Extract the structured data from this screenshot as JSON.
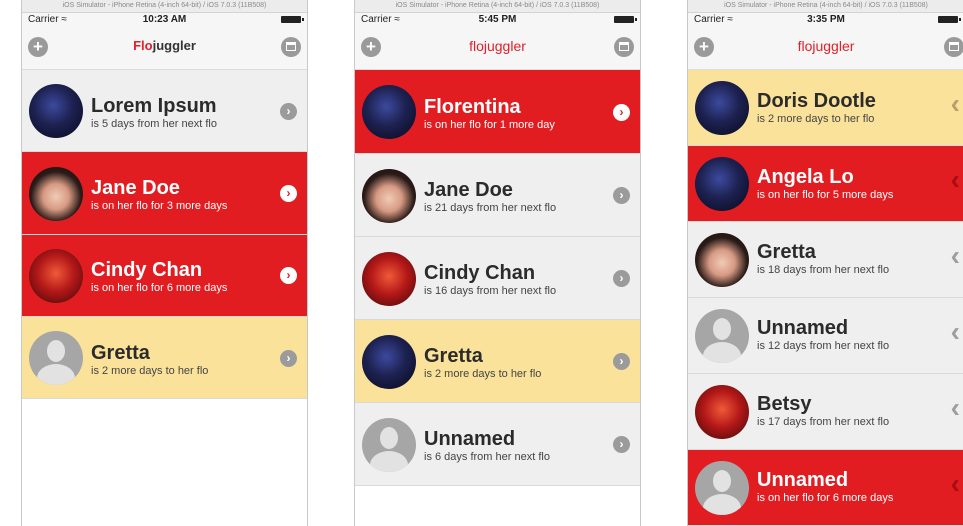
{
  "screens": [
    {
      "simulator_title": "iOS Simulator - iPhone Retina (4-inch 64-bit) / iOS 7.0.3 (11B508)",
      "carrier": "Carrier",
      "time": "10:23 AM",
      "title_part1": "Flo",
      "title_part2": "juggler",
      "rows": [
        {
          "name": "Lorem Ipsum",
          "status": "is 5 days from her next flo",
          "color": "gray"
        },
        {
          "name": "Jane Doe",
          "status": "is on her flo for 3 more days",
          "color": "red"
        },
        {
          "name": "Cindy Chan",
          "status": "is on her flo for 6 more days",
          "color": "red"
        },
        {
          "name": "Gretta",
          "status": "is 2 more days to her flo",
          "color": "yellow"
        }
      ]
    },
    {
      "simulator_title": "iOS Simulator - iPhone Retina (4-inch 64-bit) / iOS 7.0.3 (11B508)",
      "carrier": "Carrier",
      "time": "5:45 PM",
      "title": "flojuggler",
      "rows": [
        {
          "name": "Florentina",
          "status": "is on her flo for 1 more day",
          "color": "red"
        },
        {
          "name": "Jane Doe",
          "status": "is 21 days from her next flo",
          "color": "gray"
        },
        {
          "name": "Cindy Chan",
          "status": "is 16 days from her next flo",
          "color": "gray"
        },
        {
          "name": "Gretta",
          "status": "is 2 more days to her flo",
          "color": "yellow"
        },
        {
          "name": "Unnamed",
          "status": "is 6 days from her next flo",
          "color": "gray"
        }
      ]
    },
    {
      "simulator_title": "iOS Simulator - iPhone Retina (4-inch 64-bit) / iOS 7.0.3 (11B508)",
      "carrier": "Carrier",
      "time": "3:35 PM",
      "title": "flojuggler",
      "rows": [
        {
          "name": "Doris Dootle",
          "status": "is 2 more days to her flo",
          "color": "yellow"
        },
        {
          "name": "Angela Lo",
          "status": "is on her flo for 5 more days",
          "color": "red"
        },
        {
          "name": "Gretta",
          "status": "is 18 days from her next flo",
          "color": "gray"
        },
        {
          "name": "Unnamed",
          "status": "is 12 days from her next flo",
          "color": "gray"
        },
        {
          "name": "Betsy",
          "status": "is 17 days from her next flo",
          "color": "gray"
        },
        {
          "name": "Unnamed",
          "status": "is on her flo for 6 more days",
          "color": "red"
        }
      ]
    }
  ],
  "icons": {
    "add": "plus-circle-icon",
    "calendar": "calendar-icon",
    "disclosure": "chevron-right-icon",
    "swipe": "chevron-left-icon",
    "wifi": "wifi-icon",
    "battery": "battery-icon"
  },
  "colors": {
    "brand_red": "#e11d22",
    "row_gray": "#efefef",
    "row_yellow": "#fbe29a"
  }
}
